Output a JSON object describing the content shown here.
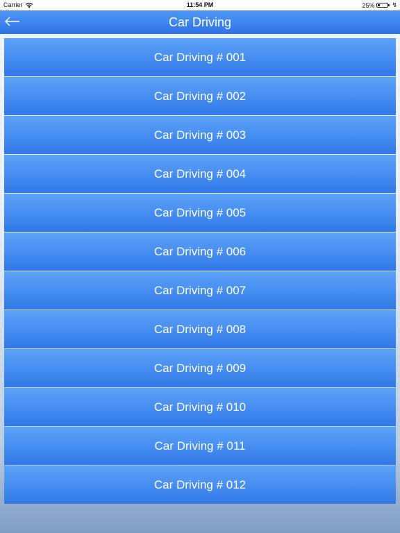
{
  "status_bar": {
    "carrier": "Carrier",
    "time": "11:54 PM",
    "battery_percent": "25%",
    "battery_level": 0.25
  },
  "header": {
    "title": "Car Driving",
    "back_icon": "back-arrow-icon"
  },
  "list": {
    "items": [
      "Car Driving # 001",
      "Car Driving # 002",
      "Car Driving # 003",
      "Car Driving # 004",
      "Car Driving # 005",
      "Car Driving # 006",
      "Car Driving # 007",
      "Car Driving # 008",
      "Car Driving # 009",
      "Car Driving # 010",
      "Car Driving # 011",
      "Car Driving # 012"
    ]
  },
  "colors": {
    "accent": "#3c82ee",
    "item_top": "#5aa2f7",
    "item_bottom": "#3278e6"
  }
}
